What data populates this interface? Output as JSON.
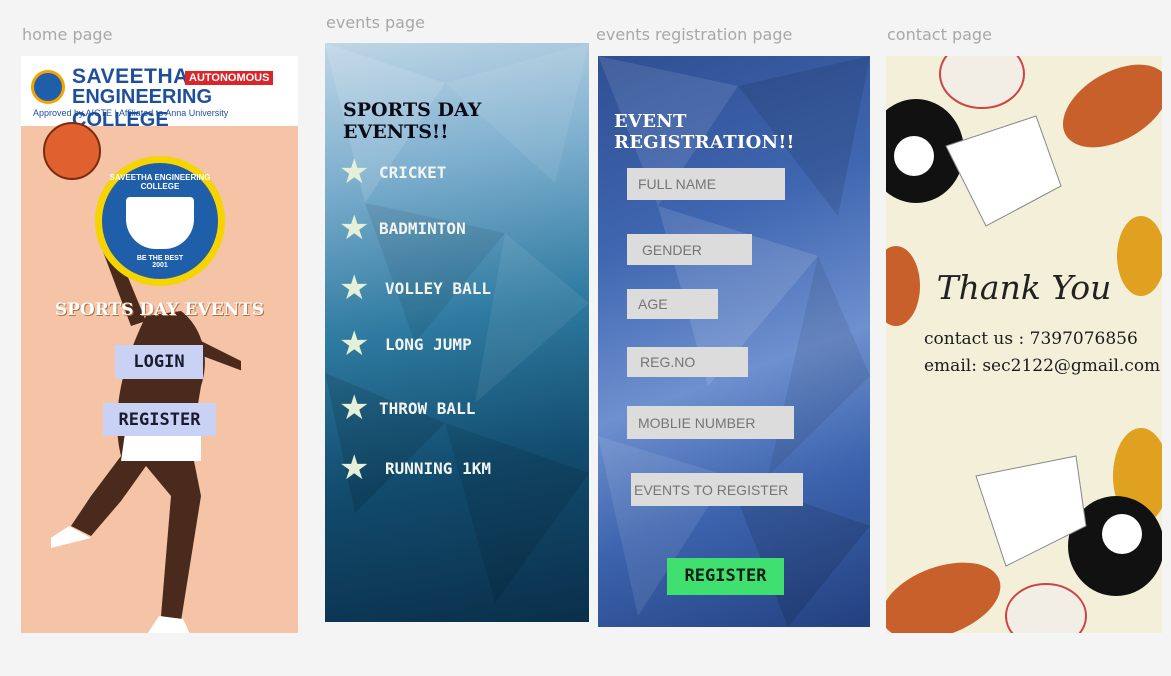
{
  "labels": {
    "home": "home page",
    "events": "events page",
    "registration": "events registration page",
    "contact": "contact page"
  },
  "home": {
    "college_line1": "SAVEETHA",
    "badge": "AUTONOMOUS",
    "college_line2": "ENGINEERING COLLEGE",
    "approval": "Approved by AICTE  |  Affiliated to Anna University",
    "seal_top": "SAVEETHA ENGINEERING COLLEGE",
    "seal_motto": "BE THE BEST",
    "seal_year": "2001",
    "headline": "SPORTS DAY EVENTS",
    "login_label": "LOGIN",
    "register_label": "REGISTER"
  },
  "events": {
    "heading": "SPORTS DAY EVENTS!!",
    "items": [
      "CRICKET",
      "BADMINTON",
      "VOLLEY BALL",
      "LONG JUMP",
      "THROW BALL",
      "RUNNING 1KM"
    ]
  },
  "registration": {
    "heading": "EVENT REGISTRATION!!",
    "fields": {
      "full_name": "FULL NAME",
      "gender": "GENDER",
      "age": "AGE",
      "reg_no": "REG.NO",
      "mobile": "MOBLIE NUMBER",
      "events": "EVENTS TO REGISTER"
    },
    "submit_label": "REGISTER"
  },
  "contact": {
    "thank_you": "Thank You",
    "contact_line": "contact us : 7397076856",
    "email_line": "email: sec2122@gmail.com"
  },
  "colors": {
    "home_bg": "#f5c3a6",
    "events_bg_top": "#bfd6e6",
    "events_bg_bottom": "#0a2f4a",
    "registration_bg": "#3f66b0",
    "register_button": "#3fe070",
    "contact_bg": "#f3efd9"
  }
}
